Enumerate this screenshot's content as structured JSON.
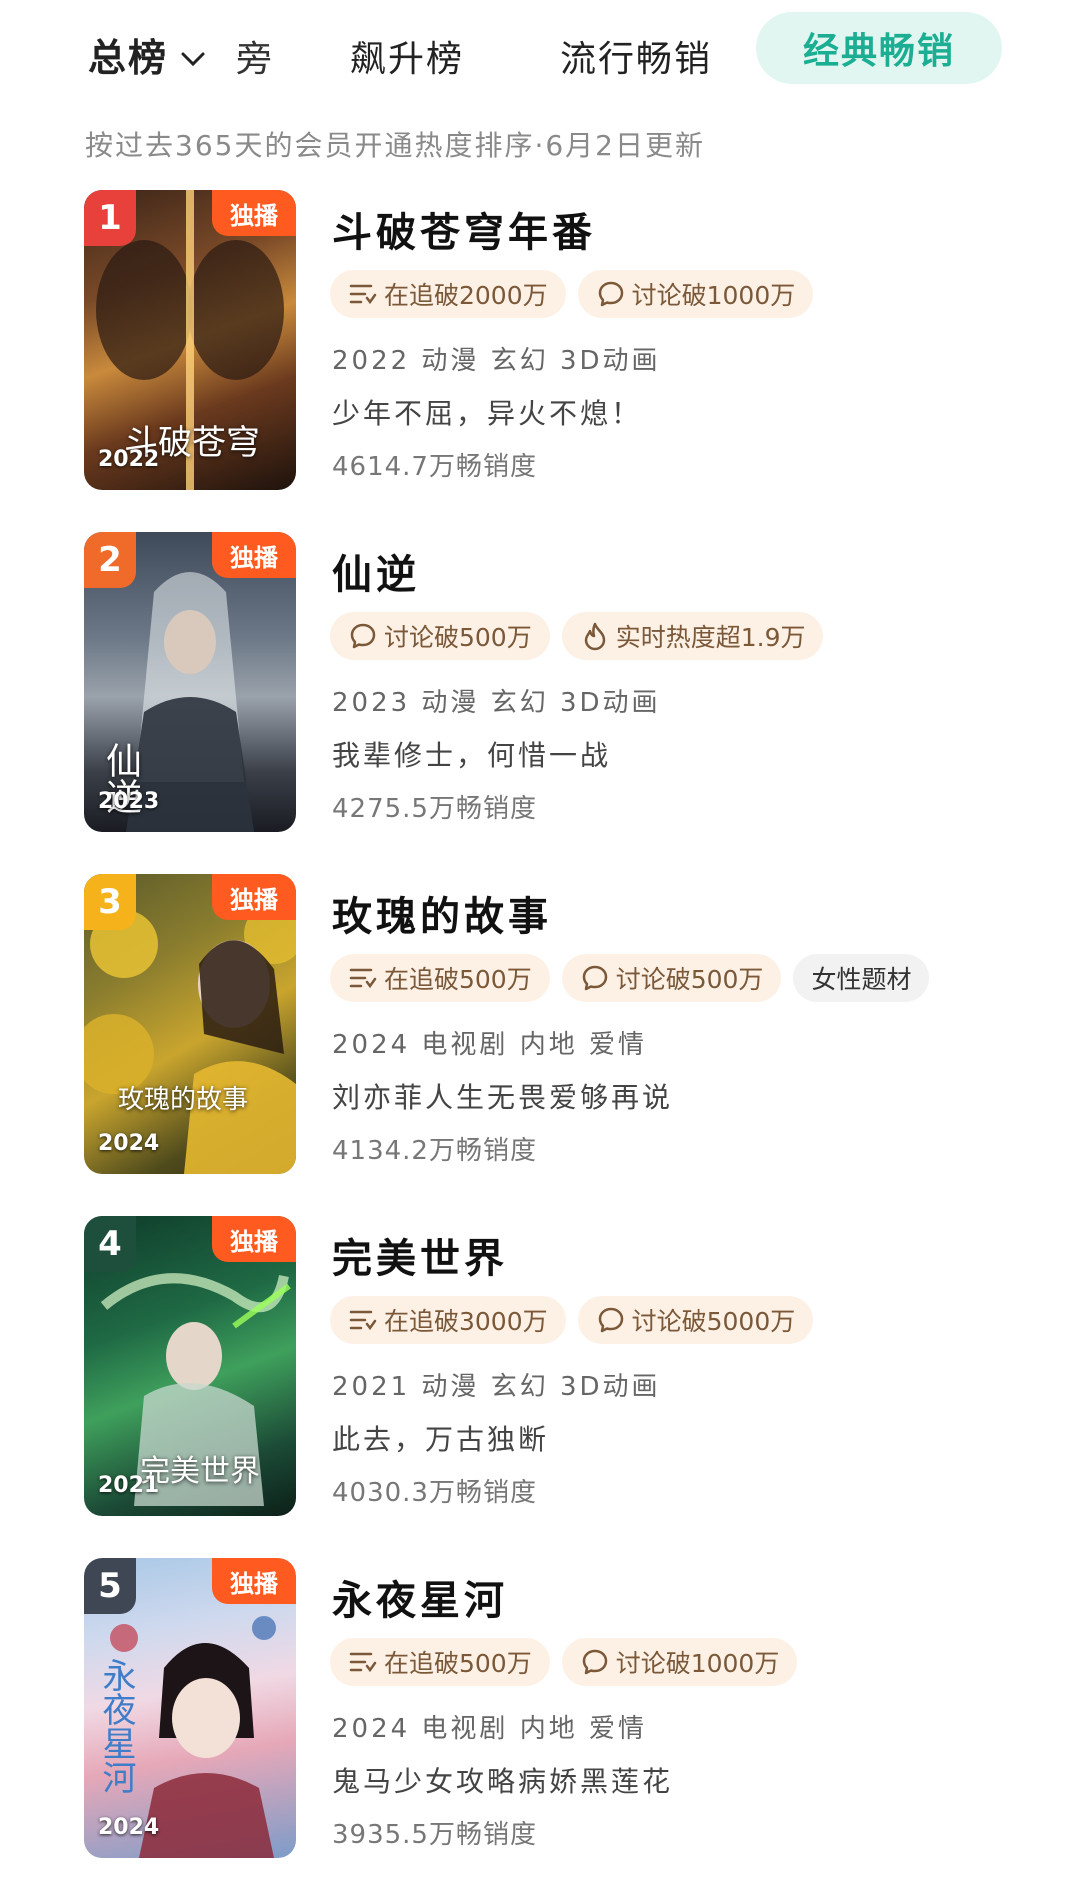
{
  "tabs": {
    "total": "总榜",
    "partial": "旁",
    "rising": "飙升榜",
    "popular": "流行畅销",
    "classic": "经典畅销"
  },
  "subtitle": "按过去365天的会员开通热度排序·6月2日更新",
  "items": [
    {
      "rank": "1",
      "rank_color": "#e8403a",
      "exclusive": "独播",
      "poster_year": "2022",
      "poster_title": "斗破苍穹",
      "title": "斗破苍穹年番",
      "tags": [
        {
          "icon": "list-icon",
          "text": "在追破2000万"
        },
        {
          "icon": "comment-icon",
          "text": "讨论破1000万"
        }
      ],
      "meta": "2022 动漫 玄幻 3D动画",
      "slogan": "少年不屈，异火不熄！",
      "sales": "4614.7万畅销度"
    },
    {
      "rank": "2",
      "rank_color": "#f06a2a",
      "exclusive": "独播",
      "poster_year": "2023",
      "poster_title": "仙逆",
      "title": "仙逆",
      "tags": [
        {
          "icon": "comment-icon",
          "text": "讨论破500万"
        },
        {
          "icon": "flame-icon",
          "text": "实时热度超1.9万"
        }
      ],
      "meta": "2023 动漫 玄幻 3D动画",
      "slogan": "我辈修士，何惜一战",
      "sales": "4275.5万畅销度"
    },
    {
      "rank": "3",
      "rank_color": "#f6b21a",
      "exclusive": "独播",
      "poster_year": "2024",
      "poster_title": "玫瑰的故事",
      "title": "玫瑰的故事",
      "tags": [
        {
          "icon": "list-icon",
          "text": "在追破500万"
        },
        {
          "icon": "comment-icon",
          "text": "讨论破500万"
        },
        {
          "icon": "",
          "text": "女性题材",
          "gray": true
        }
      ],
      "meta": "2024 电视剧 内地 爱情",
      "slogan": "刘亦菲人生无畏爱够再说",
      "sales": "4134.2万畅销度"
    },
    {
      "rank": "4",
      "rank_color": "#1d4f3c",
      "exclusive": "独播",
      "poster_year": "2021",
      "poster_title": "完美世界",
      "title": "完美世界",
      "tags": [
        {
          "icon": "list-icon",
          "text": "在追破3000万"
        },
        {
          "icon": "comment-icon",
          "text": "讨论破5000万"
        }
      ],
      "meta": "2021 动漫 玄幻 3D动画",
      "slogan": "此去，万古独断",
      "sales": "4030.3万畅销度"
    },
    {
      "rank": "5",
      "rank_color": "#3f4654",
      "exclusive": "独播",
      "poster_year": "2024",
      "poster_title": "永夜星河",
      "title": "永夜星河",
      "tags": [
        {
          "icon": "list-icon",
          "text": "在追破500万"
        },
        {
          "icon": "comment-icon",
          "text": "讨论破1000万"
        }
      ],
      "meta": "2024 电视剧 内地 爱情",
      "slogan": "鬼马少女攻略病娇黑莲花",
      "sales": "3935.5万畅销度"
    }
  ],
  "colors": {
    "accent": "#1cae92",
    "accent_bg": "#e1f6f1",
    "tag_bg": "#fdf1e6",
    "exclusive_bg": "#ff5a1f"
  }
}
